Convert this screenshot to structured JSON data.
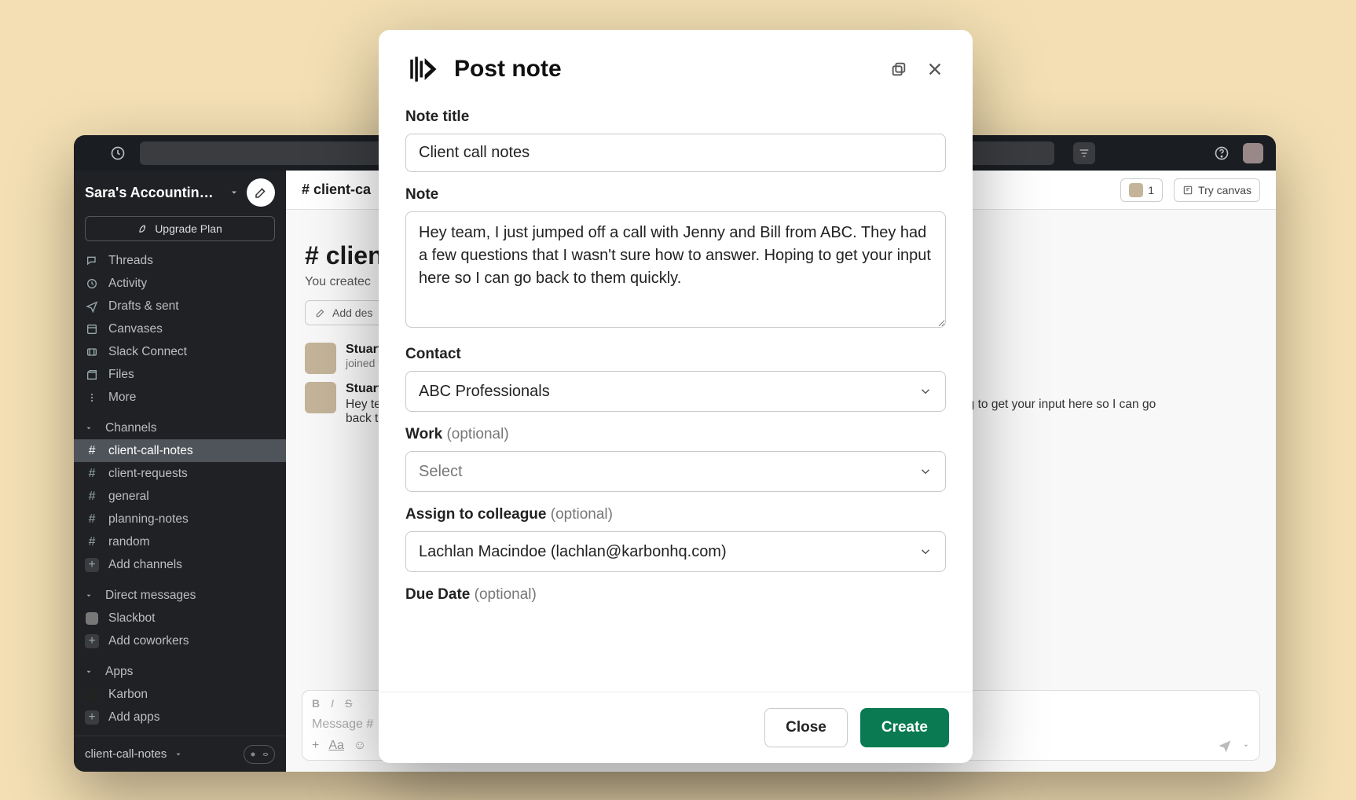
{
  "slack": {
    "workspace_name": "Sara's Accounting…",
    "upgrade_label": "Upgrade Plan",
    "nav": {
      "threads": "Threads",
      "activity": "Activity",
      "drafts": "Drafts & sent",
      "canvases": "Canvases",
      "connect": "Slack Connect",
      "files": "Files",
      "more": "More"
    },
    "sections": {
      "channels": "Channels",
      "dms": "Direct messages",
      "apps": "Apps"
    },
    "channels": [
      "client-call-notes",
      "client-requests",
      "general",
      "planning-notes",
      "random"
    ],
    "add_channels": "Add channels",
    "dms": [
      "Slackbot"
    ],
    "add_coworkers": "Add coworkers",
    "apps_list": [
      "Karbon"
    ],
    "add_apps": "Add apps",
    "footer_channel": "client-call-notes",
    "header": {
      "channel_title": "# client-ca",
      "member_count": "1",
      "try_canvas": "Try canvas"
    },
    "intro": {
      "title": "# client-call-notes",
      "subtitle_prefix": "You createc",
      "add_desc": "Add des"
    },
    "messages": [
      {
        "name": "Stuart",
        "meta": "joined t"
      },
      {
        "name": "Stuart",
        "txt_a": "Hey te",
        "txt_b": "answer. Hoping to get your input here so I can go",
        "txt_c": "back t"
      }
    ],
    "composer": {
      "placeholder": "Message #",
      "aa": "Aa"
    }
  },
  "modal": {
    "title": "Post note",
    "labels": {
      "note_title": "Note title",
      "note": "Note",
      "contact": "Contact",
      "work": "Work",
      "assign": "Assign to colleague",
      "due": "Due Date",
      "optional": "(optional)"
    },
    "values": {
      "note_title": "Client call notes",
      "note": "Hey team, I just jumped off a call with Jenny and Bill from ABC. They had a few questions that I wasn't sure how to answer. Hoping to get your input here so I can go back to them quickly.",
      "contact": "ABC Professionals",
      "work_placeholder": "Select",
      "assign": "Lachlan Macindoe (lachlan@karbonhq.com)"
    },
    "buttons": {
      "close": "Close",
      "create": "Create"
    }
  }
}
